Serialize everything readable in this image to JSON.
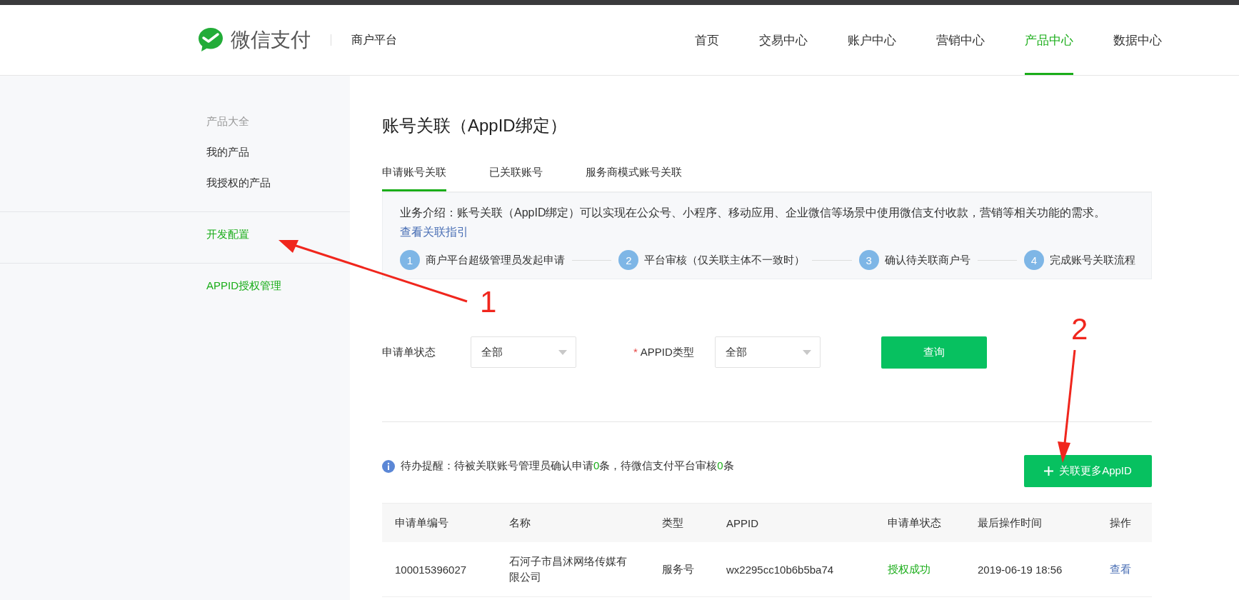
{
  "header": {
    "brand": "微信支付",
    "subtitle": "商户平台",
    "nav": [
      {
        "label": "首页",
        "selected": false
      },
      {
        "label": "交易中心",
        "selected": false
      },
      {
        "label": "账户中心",
        "selected": false
      },
      {
        "label": "营销中心",
        "selected": false
      },
      {
        "label": "产品中心",
        "selected": true
      },
      {
        "label": "数据中心",
        "selected": false
      }
    ]
  },
  "sidebar": {
    "groups": [
      {
        "items": [
          {
            "label": "产品大全",
            "kind": "heading"
          },
          {
            "label": "我的产品",
            "kind": "link"
          },
          {
            "label": "我授权的产品",
            "kind": "link"
          }
        ]
      },
      {
        "items": [
          {
            "label": "开发配置",
            "kind": "section"
          }
        ]
      },
      {
        "items": [
          {
            "label": "APPID授权管理",
            "kind": "section"
          }
        ]
      }
    ]
  },
  "page_title": "账号关联（AppID绑定）",
  "tabs": [
    {
      "label": "申请账号关联",
      "selected": true
    },
    {
      "label": "已关联账号",
      "selected": false
    },
    {
      "label": "服务商模式账号关联",
      "selected": false
    }
  ],
  "intro": {
    "text": "业务介绍：账号关联（AppID绑定）可以实现在公众号、小程序、移动应用、企业微信等场景中使用微信支付收款，营销等相关功能的需求。",
    "link": "查看关联指引"
  },
  "steps": [
    {
      "number": "1",
      "label": "商户平台超级管理员发起申请"
    },
    {
      "number": "2",
      "label": "平台审核（仅关联主体不一致时）"
    },
    {
      "number": "3",
      "label": "确认待关联商户号"
    },
    {
      "number": "4",
      "label": "完成账号关联流程"
    }
  ],
  "filters": [
    {
      "label": "申请单状态",
      "required": false,
      "value": "全部"
    },
    {
      "label": "APPID类型",
      "required": true,
      "value": "全部"
    }
  ],
  "required_mark": "*",
  "query_button": "查询",
  "notice": [
    {
      "text": "待办提醒：待被关联账号管理员确认申请",
      "kind": "text"
    },
    {
      "text": "0",
      "kind": "count"
    },
    {
      "text": "条，待微信支付平台审核",
      "kind": "text"
    },
    {
      "text": "0",
      "kind": "count"
    },
    {
      "text": "条",
      "kind": "text"
    }
  ],
  "add_button": "关联更多AppID",
  "table": {
    "columns": [
      "申请单编号",
      "名称",
      "类型",
      "APPID",
      "申请单状态",
      "最后操作时间",
      "操作"
    ],
    "rows": [
      {
        "cells": [
          "100015396027",
          "石河子市昌沭网络传媒有限公司",
          "服务号",
          "wx2295cc10b6b5ba74",
          "授权成功",
          "2019-06-19 18:56",
          "查看"
        ]
      }
    ]
  },
  "annotations": [
    {
      "label": "1"
    },
    {
      "label": "2"
    }
  ]
}
